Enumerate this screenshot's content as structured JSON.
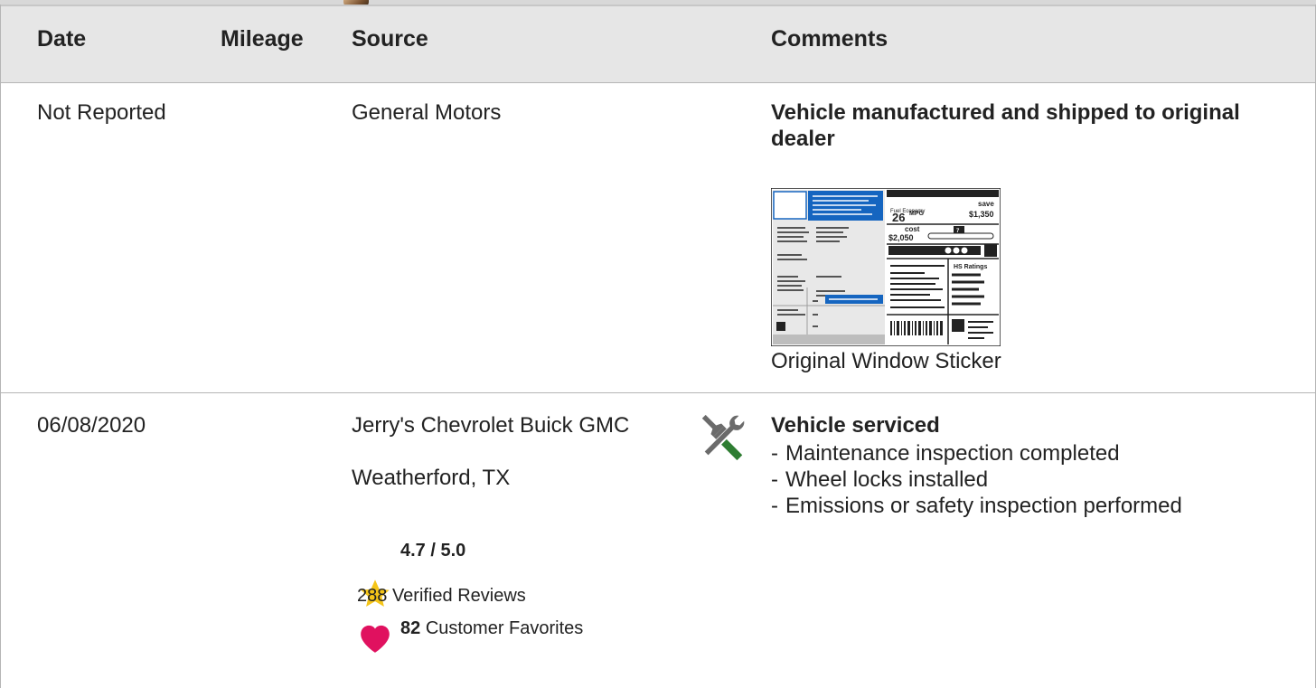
{
  "table": {
    "headers": {
      "date": "Date",
      "mileage": "Mileage",
      "source": "Source",
      "comments": "Comments"
    },
    "rows": [
      {
        "date": "Not Reported",
        "mileage": "",
        "source": "General Motors",
        "comment_title": "Vehicle manufactured and shipped to original dealer",
        "sticker": {
          "caption": "Original Window Sticker",
          "mpg": "26",
          "mpg_unit": "MPG",
          "save_label": "save",
          "save_value": "$1,350",
          "cost_label": "cost",
          "cost_value": "$2,050",
          "ratings_label": "HS Ratings",
          "scale_value": "7"
        }
      },
      {
        "date": "06/08/2020",
        "mileage": "",
        "source_name": "Jerry's Chevrolet Buick GMC",
        "source_location": "Weatherford, TX",
        "rating": "4.7 / 5.0",
        "reviews_count": "288",
        "reviews_label": "Verified Reviews",
        "favorites_count": "82",
        "favorites_label": "Customer Favorites",
        "comment_title": "Vehicle serviced",
        "comment_items": [
          "Maintenance inspection completed",
          "Wheel locks installed",
          "Emissions or safety inspection performed"
        ],
        "icon": "wrench-screwdriver-icon"
      }
    ]
  },
  "colors": {
    "header_bg": "#e6e6e6",
    "star": "#f5c518",
    "heart": "#e0115f",
    "service_icon_green": "#2e7d32",
    "service_icon_gray": "#6b6b6b",
    "sticker_blue": "#1565c0"
  }
}
